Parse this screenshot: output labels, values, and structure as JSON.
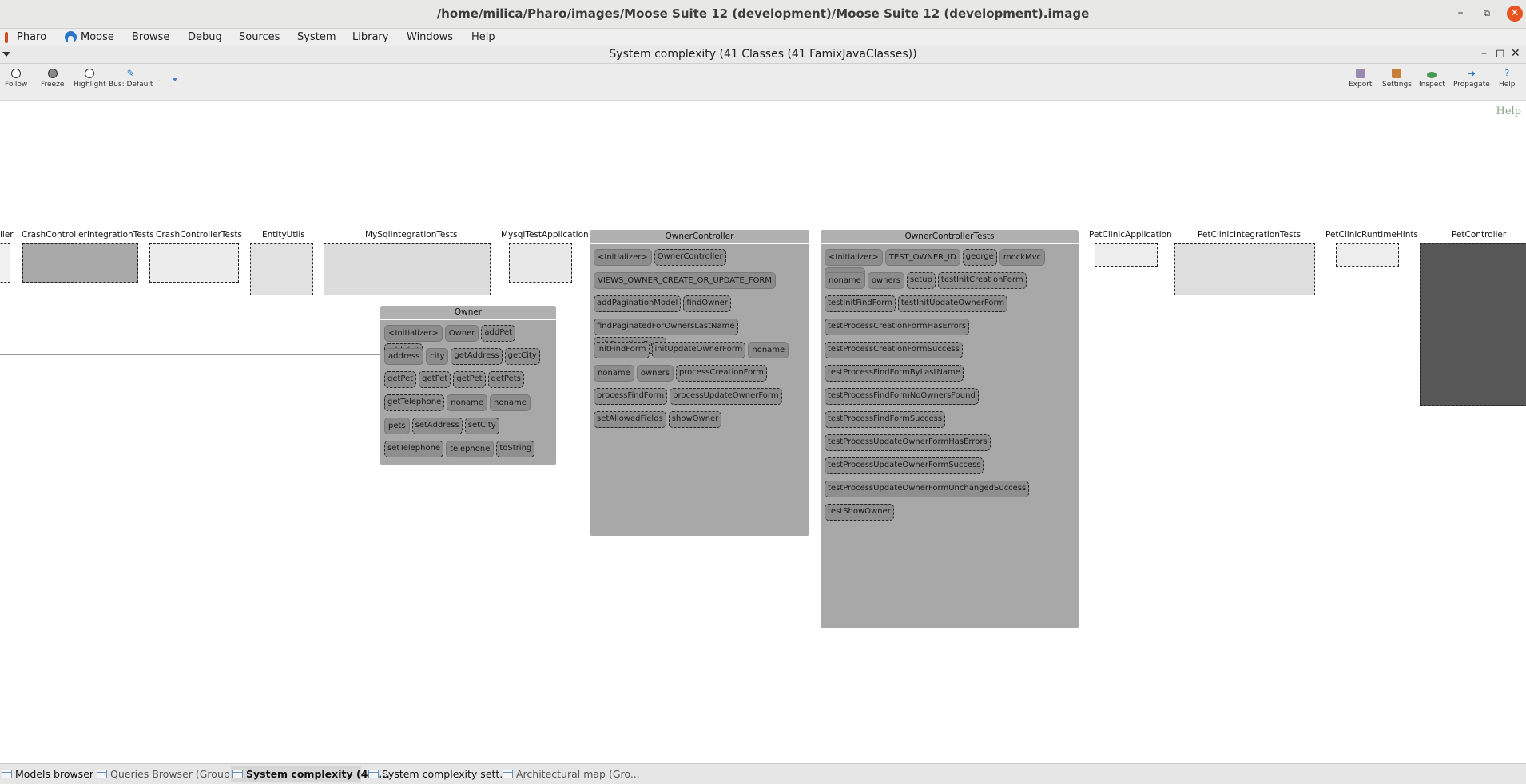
{
  "os_window": {
    "title": "/home/milica/Pharo/images/Moose Suite 12 (development)/Moose Suite 12 (development).image",
    "minimize": "–",
    "restore": "⧉",
    "close": "✕"
  },
  "menubar": {
    "items": [
      "Pharo",
      "Moose",
      "Browse",
      "Debug",
      "Sources",
      "System",
      "Library",
      "Windows",
      "Help"
    ]
  },
  "window": {
    "title": "System complexity (41 Classes (41 FamixJavaClasses))",
    "ctrl_min": "–",
    "ctrl_max": "◻",
    "ctrl_close": "✕"
  },
  "toolbar": {
    "left": [
      {
        "label": "Follow",
        "icon": "circle-open-icon"
      },
      {
        "label": "Freeze",
        "icon": "circle-filled-icon"
      },
      {
        "label": "Highlight",
        "icon": "circle-open-icon"
      },
      {
        "label": "Bus: Default",
        "icon": "pencil-icon"
      }
    ],
    "extra": "..",
    "right": [
      {
        "label": "Export",
        "icon": "export-icon"
      },
      {
        "label": "Settings",
        "icon": "settings-icon"
      },
      {
        "label": "Inspect",
        "icon": "inspect-icon"
      },
      {
        "label": "Propagate",
        "icon": "propagate-icon"
      },
      {
        "label": "Help",
        "icon": "help-icon"
      }
    ]
  },
  "canvas": {
    "help": "Help",
    "classes": [
      {
        "name": "ller"
      },
      {
        "name": "CrashControllerIntegrationTests"
      },
      {
        "name": "CrashControllerTests"
      },
      {
        "name": "EntityUtils"
      },
      {
        "name": "MySqlIntegrationTests"
      },
      {
        "name": "MysqlTestApplication"
      },
      {
        "name": "PetClinicApplication"
      },
      {
        "name": "PetClinicIntegrationTests"
      },
      {
        "name": "PetClinicRuntimeHints"
      },
      {
        "name": "PetController"
      }
    ],
    "owner": {
      "name": "Owner",
      "rows": [
        [
          "<Initializer>",
          "Owner",
          "addPet",
          "addVisit"
        ],
        [
          "address",
          "city",
          "getAddress",
          "getCity"
        ],
        [
          "getPet",
          "getPet",
          "getPet",
          "getPets"
        ],
        [
          "getTelephone",
          "noname",
          "noname"
        ],
        [
          "pets",
          "setAddress",
          "setCity"
        ],
        [
          "setTelephone",
          "telephone",
          "toString"
        ]
      ]
    },
    "owner_controller": {
      "name": "OwnerController",
      "rows": [
        [
          "<Initializer>",
          "OwnerController"
        ],
        [
          "VIEWS_OWNER_CREATE_OR_UPDATE_FORM"
        ],
        [
          "addPaginationModel",
          "findOwner"
        ],
        [
          "findPaginatedForOwnersLastName",
          "initCreationForm"
        ],
        [
          "initFindForm",
          "initUpdateOwnerForm",
          "noname"
        ],
        [
          "noname",
          "owners",
          "processCreationForm"
        ],
        [
          "processFindForm",
          "processUpdateOwnerForm"
        ],
        [
          "setAllowedFields",
          "showOwner"
        ]
      ]
    },
    "owner_controller_tests": {
      "name": "OwnerControllerTests",
      "rows": [
        [
          "<Initializer>",
          "TEST_OWNER_ID",
          "george",
          "mockMvc",
          "noname"
        ],
        [
          "noname",
          "owners",
          "setup",
          "testInitCreationForm"
        ],
        [
          "testInitFindForm",
          "testInitUpdateOwnerForm"
        ],
        [
          "testProcessCreationFormHasErrors"
        ],
        [
          "testProcessCreationFormSuccess"
        ],
        [
          "testProcessFindFormByLastName"
        ],
        [
          "testProcessFindFormNoOwnersFound"
        ],
        [
          "testProcessFindFormSuccess"
        ],
        [
          "testProcessUpdateOwnerFormHasErrors"
        ],
        [
          "testProcessUpdateOwnerFormSuccess"
        ],
        [
          "testProcessUpdateOwnerFormUnchangedSuccess"
        ],
        [
          "testShowOwner"
        ]
      ]
    }
  },
  "taskbar": {
    "items": [
      "Models browser",
      "Queries Browser (Group...",
      "System complexity (41 ...",
      "System complexity sett...",
      "Architectural map (Gro..."
    ]
  }
}
